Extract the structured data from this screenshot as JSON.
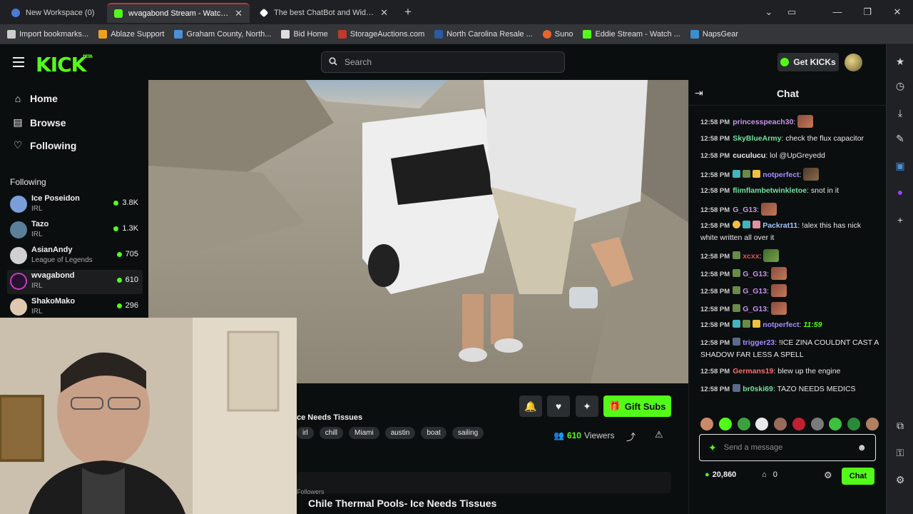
{
  "browser": {
    "tabs": [
      {
        "label": "New Workspace (0)",
        "color": "#4a7bd4"
      },
      {
        "label": "wvagabond Stream - Watch Live",
        "color": "#53fc18"
      },
      {
        "label": "The best ChatBot and Widgets fo",
        "color": "#ffffff"
      }
    ],
    "new_tab": "+",
    "bookmarks": [
      {
        "label": "Import bookmarks...",
        "color": "#cccccc"
      },
      {
        "label": "Ablaze Support",
        "color": "#f0a020"
      },
      {
        "label": "Graham County, North...",
        "color": "#4a90d9"
      },
      {
        "label": "Bid Home",
        "color": "#dddddd"
      },
      {
        "label": "StorageAuctions.com",
        "color": "#c0392b"
      },
      {
        "label": "North Carolina Resale ...",
        "color": "#2c5aa0"
      },
      {
        "label": "Suno",
        "color": "#e8642c"
      },
      {
        "label": "Eddie Stream - Watch ...",
        "color": "#53fc18"
      },
      {
        "label": "NapsGear",
        "color": "#3a8fd0"
      }
    ]
  },
  "header": {
    "logo": "KICK",
    "logo_sup": "BETA",
    "search_placeholder": "Search",
    "get_kicks": "Get KICKs"
  },
  "nav": {
    "items": [
      {
        "label": "Home",
        "icon": "home-icon"
      },
      {
        "label": "Browse",
        "icon": "browse-icon"
      },
      {
        "label": "Following",
        "icon": "heart-icon"
      }
    ],
    "following_heading": "Following",
    "channels": [
      {
        "name": "Ice Poseidon",
        "category": "IRL",
        "viewers": "3.8K",
        "color": "#7a9fd8"
      },
      {
        "name": "Tazo",
        "category": "IRL",
        "viewers": "1.3K",
        "color": "#5a7f9a"
      },
      {
        "name": "AsianAndy",
        "category": "League of Legends",
        "viewers": "705",
        "color": "#d0d0d0"
      },
      {
        "name": "wvagabond",
        "category": "IRL",
        "viewers": "610",
        "color": "#c040c0"
      },
      {
        "name": "ShakoMako",
        "category": "IRL",
        "viewers": "296",
        "color": "#e0c8b0"
      }
    ]
  },
  "stream": {
    "title_short": "ce Needs Tissues",
    "title_full": "Chile Thermal Pools- Ice Needs Tissues",
    "tags": [
      "irl",
      "chill",
      "Miami",
      "austin",
      "boat",
      "sailing"
    ],
    "viewers_count": "610",
    "viewers_label": "Viewers",
    "gift_subs": "Gift Subs",
    "followers_label": "Followers"
  },
  "chat": {
    "title": "Chat",
    "messages": [
      {
        "time": "12:58 PM",
        "user": "princesspeach30",
        "text": "",
        "color": "#c792ea"
      },
      {
        "time": "12:58 PM",
        "user": "SkyBlueArmy",
        "text": "check the flux capacitor",
        "color": "#72e0a0"
      },
      {
        "time": "12:58 PM",
        "user": "cuculucu",
        "text": "lol @UpGreyedd",
        "color": "#f0f0f0"
      },
      {
        "time": "12:58 PM",
        "user": "notperfect",
        "text": "",
        "color": "#a58cff"
      },
      {
        "time": "12:58 PM",
        "user": "flimflambetwinkletoe",
        "text": "snot in it",
        "color": "#72e0a0"
      },
      {
        "time": "12:58 PM",
        "user": "G_G13",
        "text": "",
        "color": "#c792ea"
      },
      {
        "time": "12:58 PM",
        "user": "Packrat11",
        "text": "!alex this has nick white written all over it",
        "color": "#a0c4ff"
      },
      {
        "time": "12:58 PM",
        "user": "xcxx",
        "text": "",
        "color": "#e05050"
      },
      {
        "time": "12:58 PM",
        "user": "G_G13",
        "text": "",
        "color": "#c792ea"
      },
      {
        "time": "12:58 PM",
        "user": "G_G13",
        "text": "",
        "color": "#c792ea"
      },
      {
        "time": "12:58 PM",
        "user": "G_G13",
        "text": "",
        "color": "#c792ea"
      },
      {
        "time": "12:58 PM",
        "user": "notperfect",
        "text": "11:59",
        "color": "#a58cff"
      },
      {
        "time": "12:58 PM",
        "user": "trigger23",
        "text": "!ICE ZINA COULDNT CAST A SHADOW FAR LESS A SPELL",
        "color": "#a58cff"
      },
      {
        "time": "12:58 PM",
        "user": "Germans19",
        "text": "blew up the engine",
        "color": "#ff6b6b"
      },
      {
        "time": "12:58 PM",
        "user": "br0ski69",
        "text": "TAZO NEEDS MEDICS",
        "color": "#72e0a0"
      }
    ],
    "input_placeholder": "Send a message",
    "points": "20,860",
    "subs": "0",
    "send_label": "Chat"
  },
  "colors": {
    "accent": "#53fc18",
    "bg": "#0b0e0f"
  }
}
